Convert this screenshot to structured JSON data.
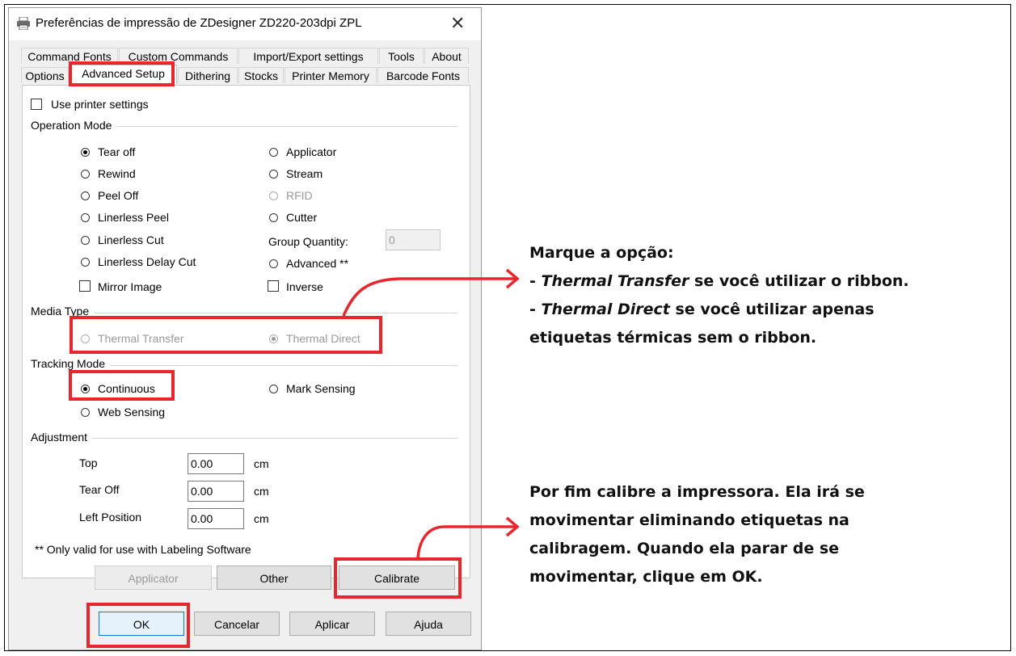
{
  "window": {
    "title": "Preferências de impressão de ZDesigner ZD220-203dpi ZPL",
    "close_glyph": "✕",
    "icon": "printer-icon"
  },
  "tabs": {
    "row1": [
      "Command Fonts",
      "Custom Commands",
      "Import/Export settings",
      "Tools",
      "About"
    ],
    "row2": [
      "Options",
      "Advanced Setup",
      "Dithering",
      "Stocks",
      "Printer Memory",
      "Barcode Fonts"
    ],
    "active": "Advanced Setup"
  },
  "panel": {
    "use_printer_settings": "Use printer settings",
    "operation_mode": {
      "label": "Operation Mode",
      "left": [
        "Tear off",
        "Rewind",
        "Peel Off",
        "Linerless Peel",
        "Linerless Cut",
        "Linerless Delay Cut"
      ],
      "right": [
        "Applicator",
        "Stream",
        "RFID",
        "Cutter"
      ],
      "group_quantity_label": "Group Quantity:",
      "group_quantity_value": "0",
      "advanced": "Advanced **",
      "mirror_image": "Mirror Image",
      "inverse": "Inverse",
      "selected": "Tear off"
    },
    "media_type": {
      "label": "Media Type",
      "thermal_transfer": "Thermal Transfer",
      "thermal_direct": "Thermal Direct",
      "selected": "Thermal Direct"
    },
    "tracking_mode": {
      "label": "Tracking Mode",
      "continuous": "Continuous",
      "mark_sensing": "Mark Sensing",
      "web_sensing": "Web Sensing",
      "selected": "Continuous"
    },
    "adjustment": {
      "label": "Adjustment",
      "top_label": "Top",
      "top_value": "0.00",
      "tear_off_label": "Tear Off",
      "tear_off_value": "0.00",
      "left_position_label": "Left Position",
      "left_position_value": "0.00",
      "unit": "cm"
    },
    "footnote": "** Only valid for use with Labeling Software",
    "buttons": {
      "applicator": "Applicator",
      "other": "Other",
      "calibrate": "Calibrate"
    }
  },
  "dialog_buttons": {
    "ok": "OK",
    "cancel": "Cancelar",
    "apply": "Aplicar",
    "help": "Ajuda"
  },
  "annotations": {
    "note1": {
      "line1": "Marque a opção:",
      "line2_em": "Thermal Transfer",
      "line2_rest": " se você utilizar o ribbon.",
      "line3_em": "Thermal Direct",
      "line3_rest": " se você utilizar apenas",
      "line4": "etiquetas térmicas sem o ribbon.",
      "dash": "- "
    },
    "note2": {
      "line1": "Por fim calibre a impressora. Ela irá se",
      "line2": "movimentar eliminando etiquetas na",
      "line3": "calibragem. Quando ela parar de se",
      "line4": "movimentar, clique em OK."
    },
    "highlight_color": "#e8262d"
  }
}
